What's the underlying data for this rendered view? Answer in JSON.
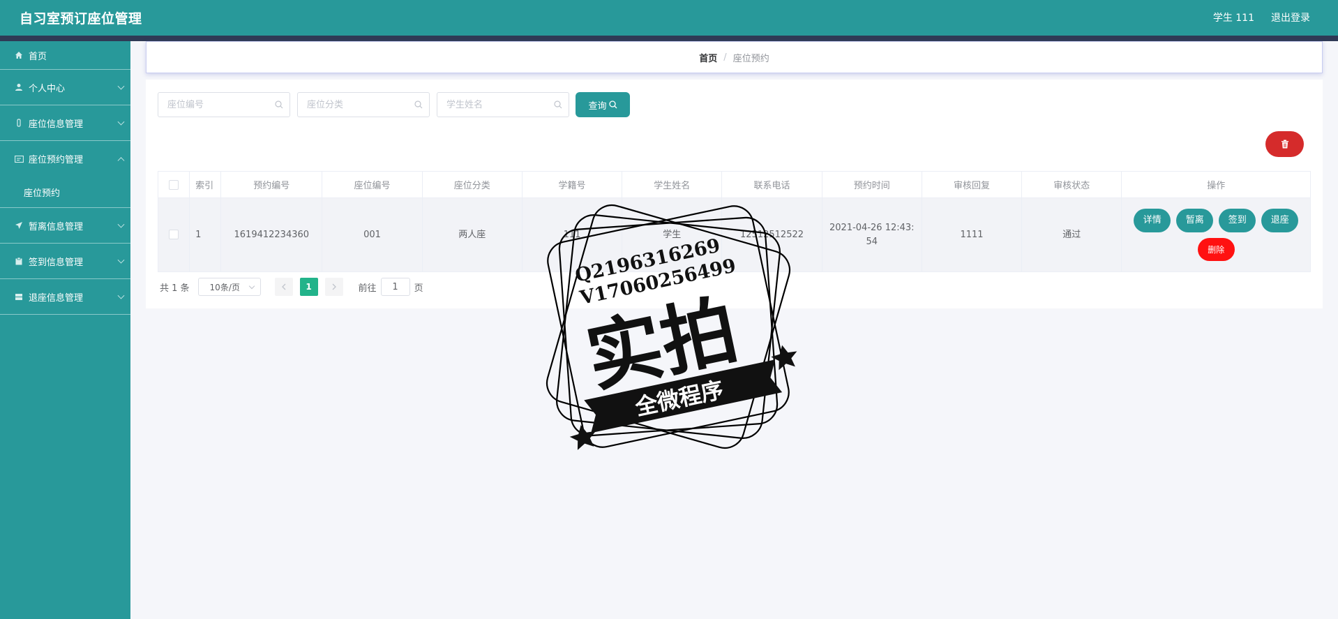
{
  "header": {
    "title": "自习室预订座位管理",
    "user": "学生 111",
    "logout": "退出登录"
  },
  "sidebar": {
    "items": [
      {
        "label": "首页",
        "icon": "home-icon"
      },
      {
        "label": "个人中心",
        "icon": "user-icon"
      },
      {
        "label": "座位信息管理",
        "icon": "seat-icon"
      },
      {
        "label": "座位预约管理",
        "icon": "reservation-icon"
      },
      {
        "label": "暂离信息管理",
        "icon": "send-icon"
      },
      {
        "label": "签到信息管理",
        "icon": "clipboard-icon"
      },
      {
        "label": "退座信息管理",
        "icon": "box-icon"
      }
    ],
    "sub_item": "座位预约"
  },
  "breadcrumb": {
    "home": "首页",
    "separator": "/",
    "current": "座位预约"
  },
  "search": {
    "seat_no_placeholder": "座位编号",
    "category_placeholder": "座位分类",
    "student_name_placeholder": "学生姓名",
    "query_label": "查询"
  },
  "table": {
    "headers": [
      "索引",
      "预约编号",
      "座位编号",
      "座位分类",
      "学籍号",
      "学生姓名",
      "联系电话",
      "预约时间",
      "审核回复",
      "审核状态",
      "操作"
    ],
    "rows": [
      {
        "index": "1",
        "reservation_no": "1619412234360",
        "seat_no": "001",
        "category": "两人座",
        "student_id": "111",
        "student_name": "学生",
        "phone": "12512512522",
        "time": "2021-04-26 12:43:54",
        "reply": "1111",
        "status": "通过"
      }
    ],
    "actions": [
      "详情",
      "暂离",
      "签到",
      "退座",
      "删除"
    ]
  },
  "pagination": {
    "total": "共 1 条",
    "page_size": "10条/页",
    "current_page": "1",
    "goto_label": "前往",
    "goto_value": "1",
    "page_suffix": "页"
  },
  "watermark": {
    "line1": "Q2196316269",
    "line2": "V17060256499",
    "main": "实拍",
    "banner": "全微程序"
  },
  "colors": {
    "primary": "#28999a",
    "danger": "#d52b2b",
    "delete": "#ff1111",
    "active_page": "#22b38a"
  }
}
